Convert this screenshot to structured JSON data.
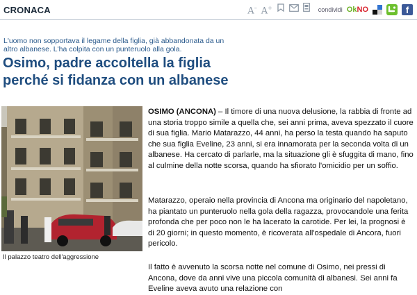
{
  "section": "CRONACA",
  "toolbar": {
    "font_smaller": "A",
    "font_larger": "A",
    "share_label": "condividi",
    "okno_ok": "Ok",
    "okno_no": "NO",
    "facebook_letter": "f"
  },
  "article": {
    "summary": "L'uomo non sopportava il legame della figlia, già abbandonata da un altro albanese. L'ha colpita con un punteruolo alla gola.",
    "headline_line1": "Osimo, padre accoltella la figlia",
    "headline_line2": "perché si fidanza con un albanese",
    "photo_caption": "Il palazzo teatro dell'aggressione",
    "lead": "OSIMO (ANCONA)",
    "paragraph1": "– Il timore di una nuova delusione, la rabbia di fronte ad una storia troppo simile a quella che, sei anni prima, aveva spezzato il cuore di sua figlia. Mario Matarazzo, 44 anni, ha perso la testa quando ha saputo che sua figlia Eveline, 23 anni, si era innamorata per la seconda volta di un albanese. Ha cercato di parlarle, ma la situazione gli è sfuggita di mano, fino al culmine della notte scorsa, quando ha sfiorato l'omicidio per un soffio.",
    "paragraph2": "Matarazzo, operaio nella provincia di Ancona ma originario del napoletano, ha piantato un punteruolo nella gola della ragazza, provocandole una ferita profonda che per poco non le ha lacerato la carotide. Per lei, la prognosi è di 20 giorni; in questo momento, è ricoverata all'ospedale di Ancora, fuori pericolo.",
    "paragraph3": "Il fatto è avvenuto la scorsa notte nel comune di Osimo, nei pressi di Ancona, dove da anni vive una piccola comunità di albanesi. Sei anni fa Eveline aveva avuto una relazione con"
  },
  "colors": {
    "headline": "#1f4d7f",
    "summary": "#2a5a8c",
    "okno_green": "#6ab023",
    "okno_red": "#d9232e",
    "facebook": "#3b5998"
  }
}
